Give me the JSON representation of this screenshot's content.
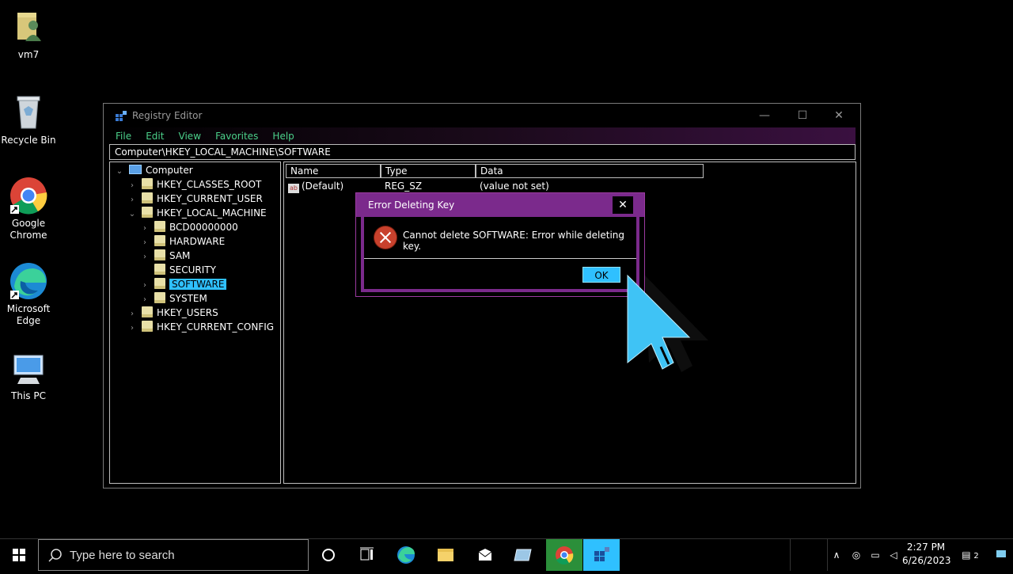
{
  "desktop": {
    "icons": [
      {
        "label": "vm7"
      },
      {
        "label": "Recycle Bin"
      },
      {
        "label": "Google\nChrome",
        "line1": "Google",
        "line2": "Chrome"
      },
      {
        "label": "Microsoft Edge",
        "line1": "Microsoft",
        "line2": "Edge"
      },
      {
        "label": "This PC"
      }
    ]
  },
  "window": {
    "title": "Registry Editor",
    "controls": {
      "minimize": "—",
      "maximize": "☐",
      "close": "✕"
    },
    "menu": [
      "File",
      "Edit",
      "View",
      "Favorites",
      "Help"
    ],
    "address": "Computer\\HKEY_LOCAL_MACHINE\\SOFTWARE",
    "tree": {
      "root": "Computer",
      "hives": [
        "HKEY_CLASSES_ROOT",
        "HKEY_CURRENT_USER",
        "HKEY_LOCAL_MACHINE",
        "HKEY_USERS",
        "HKEY_CURRENT_CONFIG"
      ],
      "hklm_children": [
        "BCD00000000",
        "HARDWARE",
        "SAM",
        "SECURITY",
        "SOFTWARE",
        "SYSTEM"
      ],
      "selected": "SOFTWARE"
    },
    "list": {
      "columns": [
        "Name",
        "Type",
        "Data"
      ],
      "rows": [
        {
          "name": "(Default)",
          "type": "REG_SZ",
          "data": "(value not set)"
        }
      ]
    }
  },
  "dialog": {
    "title": "Error Deleting Key",
    "close": "✕",
    "message": "Cannot delete SOFTWARE:  Error while deleting key.",
    "ok_label": "OK"
  },
  "taskbar": {
    "search_placeholder": "Type here to search",
    "time": "2:27 PM",
    "date": "6/26/2023",
    "notification_count": "2"
  },
  "colors": {
    "accent": "#2fc0ff",
    "dialog_title": "#7b2a8c",
    "menu_text": "#4bd08a",
    "error": "#c8412d"
  }
}
